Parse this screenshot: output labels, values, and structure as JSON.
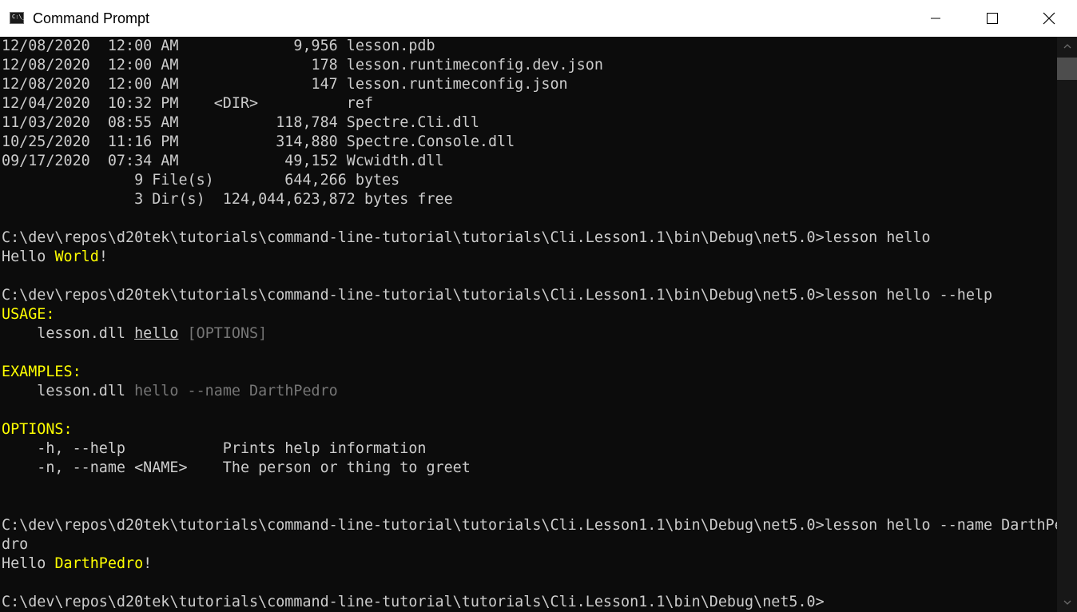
{
  "window": {
    "title": "Command Prompt",
    "icon_label": "C:\\_",
    "controls": {
      "minimize": "minimize-icon",
      "maximize": "maximize-icon",
      "close": "close-icon"
    }
  },
  "console": {
    "dir_listing": [
      "12/08/2020  12:00 AM             9,956 lesson.pdb",
      "12/08/2020  12:00 AM               178 lesson.runtimeconfig.dev.json",
      "12/08/2020  12:00 AM               147 lesson.runtimeconfig.json",
      "12/04/2020  10:32 PM    <DIR>          ref",
      "11/03/2020  08:55 AM           118,784 Spectre.Cli.dll",
      "10/25/2020  11:16 PM           314,880 Spectre.Console.dll",
      "09/17/2020  07:34 AM            49,152 Wcwidth.dll",
      "               9 File(s)        644,266 bytes",
      "               3 Dir(s)  124,044,623,872 bytes free"
    ],
    "prompt_path": "C:\\dev\\repos\\d20tek\\tutorials\\command-line-tutorial\\tutorials\\Cli.Lesson1.1\\bin\\Debug\\net5.0>",
    "cmd1": "lesson hello",
    "out1": {
      "prefix": "Hello ",
      "name": "World",
      "suffix": "!"
    },
    "cmd2": "lesson hello --help",
    "help": {
      "usage_heading": "USAGE:",
      "usage_prefix": "    lesson.dll ",
      "usage_command": "hello",
      "usage_space": " ",
      "usage_options": "[OPTIONS]",
      "examples_heading": "EXAMPLES:",
      "example_prefix": "    lesson.dll ",
      "example_args": "hello --name ",
      "example_value": "DarthPedro",
      "options_heading": "OPTIONS:",
      "option_lines": [
        "    -h, --help           Prints help information",
        "    -n, --name <NAME>    The person or thing to greet"
      ]
    },
    "cmd3_line1": "lesson hello --name DarthPe",
    "cmd3_line2": "dro",
    "out3": {
      "prefix": "Hello ",
      "name": "DarthPedro",
      "suffix": "!"
    }
  },
  "colors": {
    "background": "#0c0c0c",
    "text": "#cccccc",
    "highlight": "#ffff00",
    "dim": "#767676"
  }
}
